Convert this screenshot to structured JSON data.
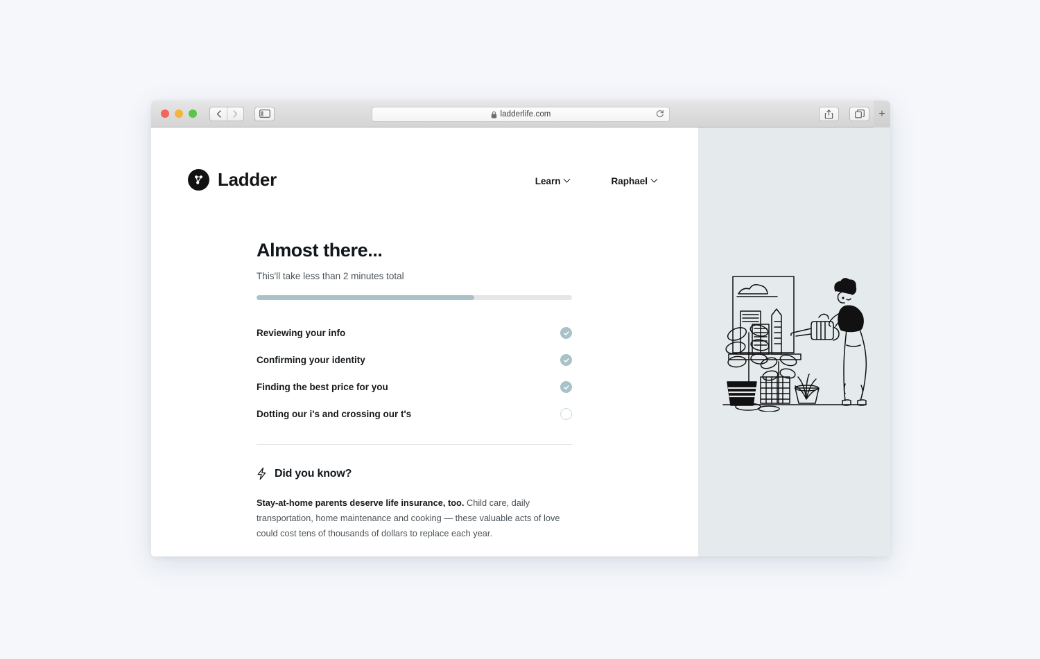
{
  "browser": {
    "url": "ladderlife.com",
    "lock_icon": "lock-icon",
    "reload_icon": "reload-icon",
    "back_icon": "chevron-left-icon",
    "forward_icon": "chevron-right-icon",
    "sidebar_icon": "sidebar-toggle-icon",
    "share_icon": "share-icon",
    "tabs_icon": "tabs-overview-icon",
    "new_tab_label": "+"
  },
  "header": {
    "brand_name": "Ladder",
    "brand_logo": "ladder-logo-icon",
    "nav": [
      {
        "label": "Learn",
        "icon": "chevron-down-icon"
      },
      {
        "label": "Raphael",
        "icon": "chevron-down-icon"
      }
    ]
  },
  "main": {
    "title": "Almost there...",
    "subtitle": "This'll take less than 2 minutes total",
    "progress_percent": 69,
    "steps": [
      {
        "label": "Reviewing your info",
        "state": "done"
      },
      {
        "label": "Confirming your identity",
        "state": "done"
      },
      {
        "label": "Finding the best price for you",
        "state": "done"
      },
      {
        "label": "Dotting our i's and crossing our t's",
        "state": "pending"
      }
    ],
    "did_you_know": {
      "icon": "lightning-bolt-icon",
      "title": "Did you know?",
      "lead": "Stay-at-home parents deserve life insurance, too.",
      "body": " Child care, daily transportation, home maintenance and cooking — these valuable acts of love could cost tens of thousands of dollars to replace each year."
    }
  },
  "illustration": {
    "name": "person-watering-plants-illustration"
  },
  "colors": {
    "accent": "#a8c2c8",
    "panel": "#e5ebed",
    "track": "#e6e6e6",
    "page_bg": "#f5f7fb"
  }
}
